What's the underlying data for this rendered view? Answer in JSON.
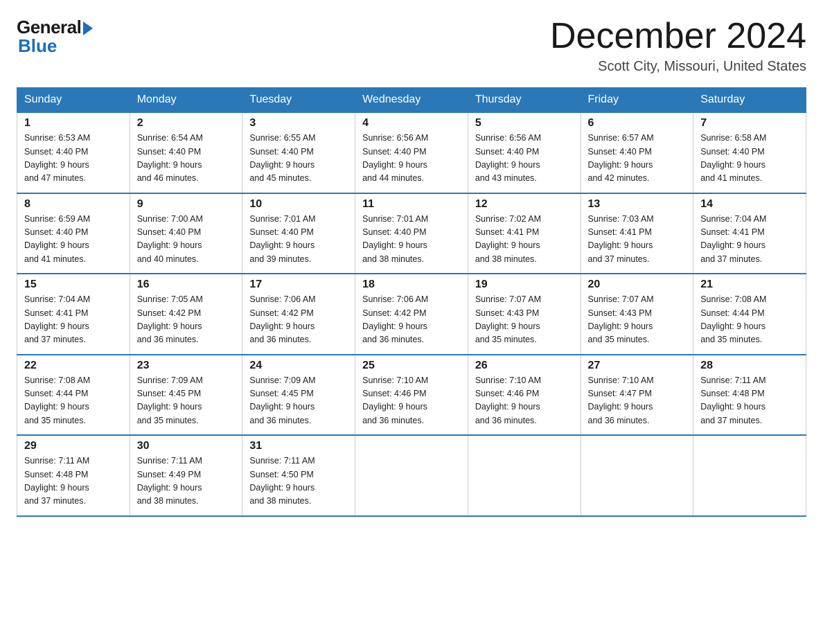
{
  "header": {
    "logo_general": "General",
    "logo_blue": "Blue",
    "title": "December 2024",
    "location": "Scott City, Missouri, United States"
  },
  "weekdays": [
    "Sunday",
    "Monday",
    "Tuesday",
    "Wednesday",
    "Thursday",
    "Friday",
    "Saturday"
  ],
  "weeks": [
    [
      {
        "day": "1",
        "sunrise": "6:53 AM",
        "sunset": "4:40 PM",
        "daylight": "9 hours and 47 minutes."
      },
      {
        "day": "2",
        "sunrise": "6:54 AM",
        "sunset": "4:40 PM",
        "daylight": "9 hours and 46 minutes."
      },
      {
        "day": "3",
        "sunrise": "6:55 AM",
        "sunset": "4:40 PM",
        "daylight": "9 hours and 45 minutes."
      },
      {
        "day": "4",
        "sunrise": "6:56 AM",
        "sunset": "4:40 PM",
        "daylight": "9 hours and 44 minutes."
      },
      {
        "day": "5",
        "sunrise": "6:56 AM",
        "sunset": "4:40 PM",
        "daylight": "9 hours and 43 minutes."
      },
      {
        "day": "6",
        "sunrise": "6:57 AM",
        "sunset": "4:40 PM",
        "daylight": "9 hours and 42 minutes."
      },
      {
        "day": "7",
        "sunrise": "6:58 AM",
        "sunset": "4:40 PM",
        "daylight": "9 hours and 41 minutes."
      }
    ],
    [
      {
        "day": "8",
        "sunrise": "6:59 AM",
        "sunset": "4:40 PM",
        "daylight": "9 hours and 41 minutes."
      },
      {
        "day": "9",
        "sunrise": "7:00 AM",
        "sunset": "4:40 PM",
        "daylight": "9 hours and 40 minutes."
      },
      {
        "day": "10",
        "sunrise": "7:01 AM",
        "sunset": "4:40 PM",
        "daylight": "9 hours and 39 minutes."
      },
      {
        "day": "11",
        "sunrise": "7:01 AM",
        "sunset": "4:40 PM",
        "daylight": "9 hours and 38 minutes."
      },
      {
        "day": "12",
        "sunrise": "7:02 AM",
        "sunset": "4:41 PM",
        "daylight": "9 hours and 38 minutes."
      },
      {
        "day": "13",
        "sunrise": "7:03 AM",
        "sunset": "4:41 PM",
        "daylight": "9 hours and 37 minutes."
      },
      {
        "day": "14",
        "sunrise": "7:04 AM",
        "sunset": "4:41 PM",
        "daylight": "9 hours and 37 minutes."
      }
    ],
    [
      {
        "day": "15",
        "sunrise": "7:04 AM",
        "sunset": "4:41 PM",
        "daylight": "9 hours and 37 minutes."
      },
      {
        "day": "16",
        "sunrise": "7:05 AM",
        "sunset": "4:42 PM",
        "daylight": "9 hours and 36 minutes."
      },
      {
        "day": "17",
        "sunrise": "7:06 AM",
        "sunset": "4:42 PM",
        "daylight": "9 hours and 36 minutes."
      },
      {
        "day": "18",
        "sunrise": "7:06 AM",
        "sunset": "4:42 PM",
        "daylight": "9 hours and 36 minutes."
      },
      {
        "day": "19",
        "sunrise": "7:07 AM",
        "sunset": "4:43 PM",
        "daylight": "9 hours and 35 minutes."
      },
      {
        "day": "20",
        "sunrise": "7:07 AM",
        "sunset": "4:43 PM",
        "daylight": "9 hours and 35 minutes."
      },
      {
        "day": "21",
        "sunrise": "7:08 AM",
        "sunset": "4:44 PM",
        "daylight": "9 hours and 35 minutes."
      }
    ],
    [
      {
        "day": "22",
        "sunrise": "7:08 AM",
        "sunset": "4:44 PM",
        "daylight": "9 hours and 35 minutes."
      },
      {
        "day": "23",
        "sunrise": "7:09 AM",
        "sunset": "4:45 PM",
        "daylight": "9 hours and 35 minutes."
      },
      {
        "day": "24",
        "sunrise": "7:09 AM",
        "sunset": "4:45 PM",
        "daylight": "9 hours and 36 minutes."
      },
      {
        "day": "25",
        "sunrise": "7:10 AM",
        "sunset": "4:46 PM",
        "daylight": "9 hours and 36 minutes."
      },
      {
        "day": "26",
        "sunrise": "7:10 AM",
        "sunset": "4:46 PM",
        "daylight": "9 hours and 36 minutes."
      },
      {
        "day": "27",
        "sunrise": "7:10 AM",
        "sunset": "4:47 PM",
        "daylight": "9 hours and 36 minutes."
      },
      {
        "day": "28",
        "sunrise": "7:11 AM",
        "sunset": "4:48 PM",
        "daylight": "9 hours and 37 minutes."
      }
    ],
    [
      {
        "day": "29",
        "sunrise": "7:11 AM",
        "sunset": "4:48 PM",
        "daylight": "9 hours and 37 minutes."
      },
      {
        "day": "30",
        "sunrise": "7:11 AM",
        "sunset": "4:49 PM",
        "daylight": "9 hours and 38 minutes."
      },
      {
        "day": "31",
        "sunrise": "7:11 AM",
        "sunset": "4:50 PM",
        "daylight": "9 hours and 38 minutes."
      },
      null,
      null,
      null,
      null
    ]
  ],
  "labels": {
    "sunrise": "Sunrise:",
    "sunset": "Sunset:",
    "daylight": "Daylight:"
  }
}
